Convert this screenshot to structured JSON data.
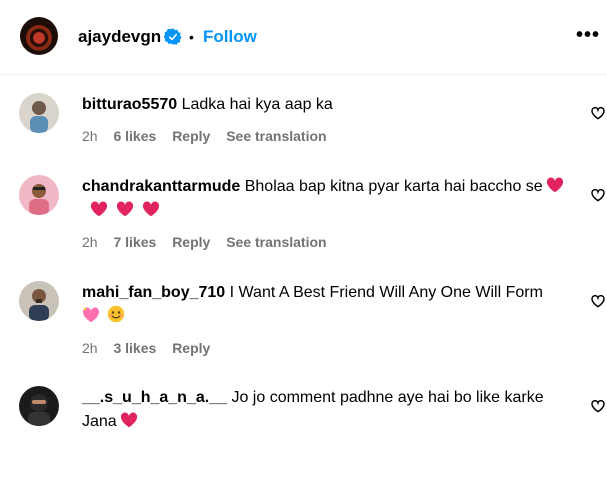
{
  "post_header": {
    "username": "ajaydevgn",
    "dot": "•",
    "follow_label": "Follow",
    "more_label": "•••",
    "verified_color": "#0095f6"
  },
  "icons": {
    "verified": "verified-badge-icon",
    "more": "more-options-icon",
    "like": "heart-outline-icon",
    "red_heart": "red-heart-emoji",
    "pink_heart": "sparkling-heart-emoji",
    "smile": "smiling-face-emoji"
  },
  "comments": [
    {
      "username": "bitturao5570",
      "text": "Ladka hai kya aap ka",
      "time": "2h",
      "likes": "6 likes",
      "reply": "Reply",
      "translation": "See translation"
    },
    {
      "username": "chandrakanttarmude",
      "text": "Bholaa bap kitna pyar karta hai baccho se",
      "time": "2h",
      "likes": "7 likes",
      "reply": "Reply",
      "translation": "See translation"
    },
    {
      "username": "mahi_fan_boy_710",
      "text": "I Want A Best Friend Will Any One Will Form",
      "time": "2h",
      "likes": "3 likes",
      "reply": "Reply"
    },
    {
      "username": "__.s_u_h_a_n_a.__",
      "text": "Jo jo comment padhne aye hai bo like karke Jana"
    }
  ],
  "colors": {
    "accent": "#0095f6",
    "meta": "#737373",
    "heart_red": "#e0245e"
  }
}
